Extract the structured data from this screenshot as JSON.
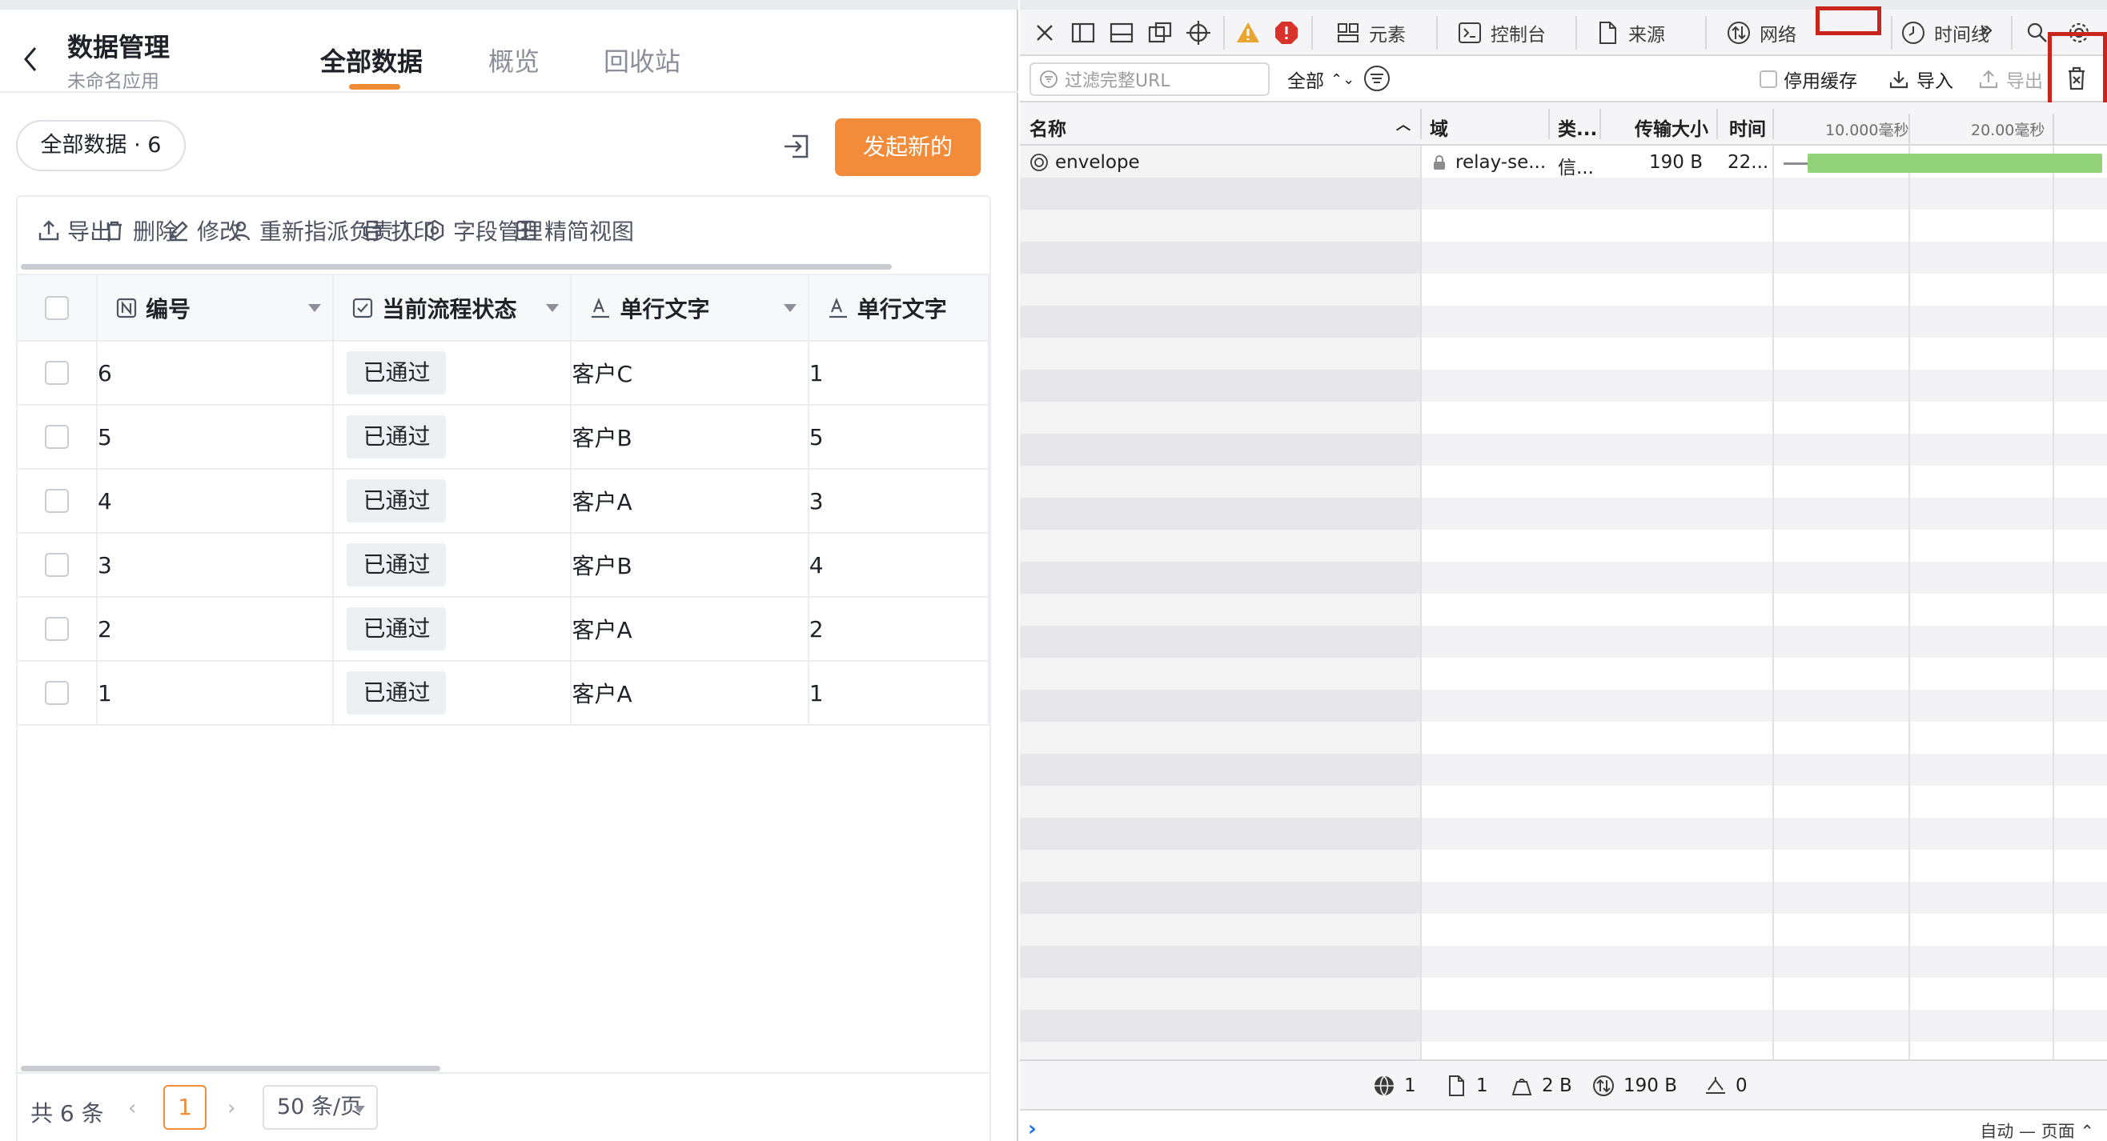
{
  "app": {
    "title": "数据管理",
    "subtitle": "未命名应用",
    "tabs": [
      {
        "label": "全部数据",
        "active": true
      },
      {
        "label": "概览",
        "active": false
      },
      {
        "label": "回收站",
        "active": false
      }
    ],
    "view_chip": "全部数据 · 6",
    "primary_button": "发起新的",
    "accent_color": "#f28b3a",
    "toolbar": {
      "export": "导出",
      "delete": "删除",
      "edit": "修改",
      "reassign": "重新指派负责人",
      "print": "打印",
      "fields": "字段管理",
      "compact_view": "精简视图"
    },
    "table": {
      "columns": [
        "编号",
        "当前流程状态",
        "单行文字",
        "单行文字"
      ],
      "rows": [
        {
          "id": "6",
          "status": "已通过",
          "text1": "客户C",
          "text2": "1"
        },
        {
          "id": "5",
          "status": "已通过",
          "text1": "客户B",
          "text2": "5"
        },
        {
          "id": "4",
          "status": "已通过",
          "text1": "客户A",
          "text2": "3"
        },
        {
          "id": "3",
          "status": "已通过",
          "text1": "客户B",
          "text2": "4"
        },
        {
          "id": "2",
          "status": "已通过",
          "text1": "客户A",
          "text2": "2"
        },
        {
          "id": "1",
          "status": "已通过",
          "text1": "客户A",
          "text2": "1"
        }
      ]
    },
    "pagination": {
      "total": "共 6 条",
      "prev": "‹",
      "current_page": "1",
      "next": "›",
      "page_size": "50 条/页"
    }
  },
  "devtools": {
    "tabs": {
      "elements": "元素",
      "console": "控制台",
      "sources": "来源",
      "network": "网络",
      "timelines": "时间线"
    },
    "overflow": "»",
    "filter_placeholder": "过滤完整URL",
    "type_filter": "全部",
    "disable_cache": "停用缓存",
    "import": "导入",
    "export": "导出",
    "columns": {
      "name": "名称",
      "domain": "域",
      "type": "类...",
      "transfer_size": "传输大小",
      "time": "时间"
    },
    "waterfall_ticks": [
      "10.000毫秒",
      "20.00毫秒"
    ],
    "requests": [
      {
        "name": "envelope",
        "domain": "relay-se...",
        "type": "信...",
        "size": "190 B",
        "time": "22..."
      }
    ],
    "summary": {
      "requests": "1",
      "resources": "1",
      "resource_size": "2 B",
      "transferred": "190 B",
      "time": "0"
    },
    "console_prompt": "›",
    "console_mode": "自动 — 页面 ⌃"
  }
}
